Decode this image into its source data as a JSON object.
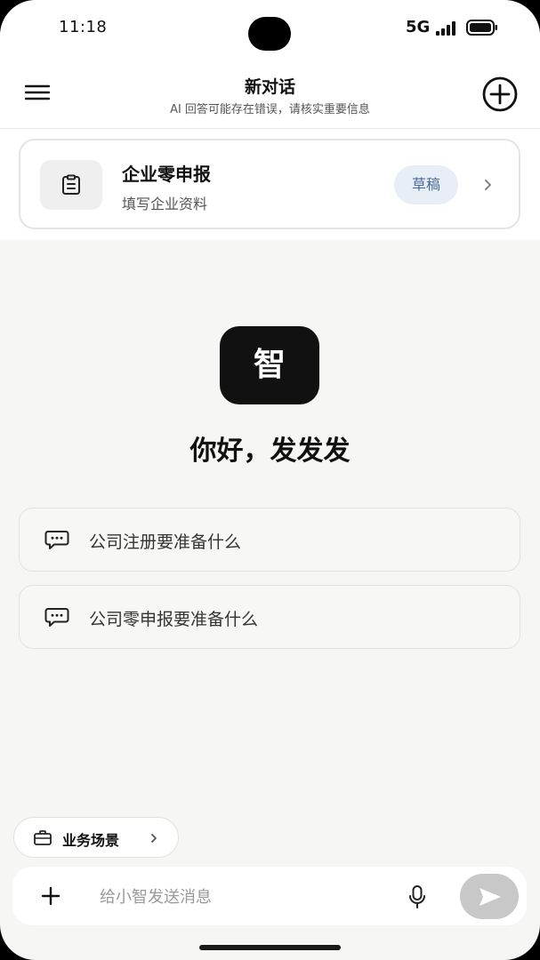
{
  "status_bar": {
    "time": "11:18",
    "network": "5G"
  },
  "header": {
    "title": "新对话",
    "subtitle": "AI 回答可能存在错误，请核实重要信息"
  },
  "task_card": {
    "title": "企业零申报",
    "subtitle": "填写企业资料",
    "badge": "草稿"
  },
  "assistant": {
    "logo_char": "智",
    "greeting": "你好，发发发"
  },
  "suggestions": [
    {
      "text": "公司注册要准备什么"
    },
    {
      "text": "公司零申报要准备什么"
    }
  ],
  "scene_button": {
    "label": "业务场景"
  },
  "composer": {
    "placeholder": "给小智发送消息"
  },
  "colors": {
    "background": "#f6f6f4",
    "badge_bg": "#e8eef6",
    "badge_text": "#4a6c9a",
    "send_disabled": "#c8c8c8"
  }
}
